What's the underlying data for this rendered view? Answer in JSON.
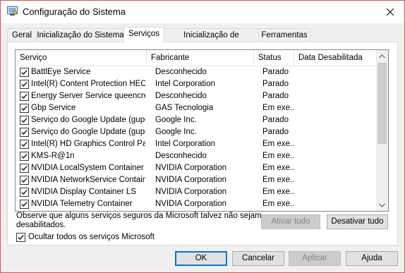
{
  "window": {
    "title": "Configuração do Sistema",
    "title_icon": "system-config-icon",
    "close_icon": "close-icon"
  },
  "tabs": [
    {
      "label": "Geral",
      "active": false
    },
    {
      "label": "Inicialização do Sistema",
      "active": false
    },
    {
      "label": "Serviços",
      "active": true
    },
    {
      "label": "Inicialização de Programas",
      "active": false
    },
    {
      "label": "Ferramentas",
      "active": false
    }
  ],
  "services": {
    "columns": {
      "service": "Serviço",
      "manufacturer": "Fabricante",
      "status": "Status",
      "disabled_date": "Data Desabilitada"
    },
    "rows": [
      {
        "name": "BattlEye Service",
        "manufacturer": "Desconhecido",
        "status": "Parado",
        "checked": true
      },
      {
        "name": "Intel(R) Content Protection HEC...",
        "manufacturer": "Intel Corporation",
        "status": "Parado",
        "checked": true
      },
      {
        "name": "Energy Server Service queencreek",
        "manufacturer": "Desconhecido",
        "status": "Parado",
        "checked": true
      },
      {
        "name": "Gbp Service",
        "manufacturer": "GAS Tecnologia",
        "status": "Em exe...",
        "checked": true
      },
      {
        "name": "Serviço do Google Update (gupd...",
        "manufacturer": "Google Inc.",
        "status": "Parado",
        "checked": true
      },
      {
        "name": "Serviço do Google Update (gupd...",
        "manufacturer": "Google Inc.",
        "status": "Parado",
        "checked": true
      },
      {
        "name": "Intel(R) HD Graphics Control Pa...",
        "manufacturer": "Intel Corporation",
        "status": "Em exe...",
        "checked": true
      },
      {
        "name": "KMS-R@1n",
        "manufacturer": "Desconhecido",
        "status": "Em exe...",
        "checked": true
      },
      {
        "name": "NVIDIA LocalSystem Container",
        "manufacturer": "NVIDIA Corporation",
        "status": "Em exe...",
        "checked": true
      },
      {
        "name": "NVIDIA NetworkService Container",
        "manufacturer": "NVIDIA Corporation",
        "status": "Em exe...",
        "checked": true
      },
      {
        "name": "NVIDIA Display Container LS",
        "manufacturer": "NVIDIA Corporation",
        "status": "Em exe...",
        "checked": true
      },
      {
        "name": "NVIDIA Telemetry Container",
        "manufacturer": "NVIDIA Corporation",
        "status": "Em exe...",
        "checked": true
      }
    ]
  },
  "note": "Observe que alguns serviços seguros da Microsoft talvez não sejam desabilitados.",
  "buttons": {
    "enable_all": "Ativar tudo",
    "disable_all": "Desativar tudo",
    "ok": "OK",
    "cancel": "Cancelar",
    "apply": "Aplicar",
    "help": "Ajuda"
  },
  "hide_ms": {
    "label": "Ocultar todos os serviços Microsoft",
    "checked": true
  },
  "colors": {
    "accent": "#0078d7",
    "window_border": "#d9534f"
  }
}
